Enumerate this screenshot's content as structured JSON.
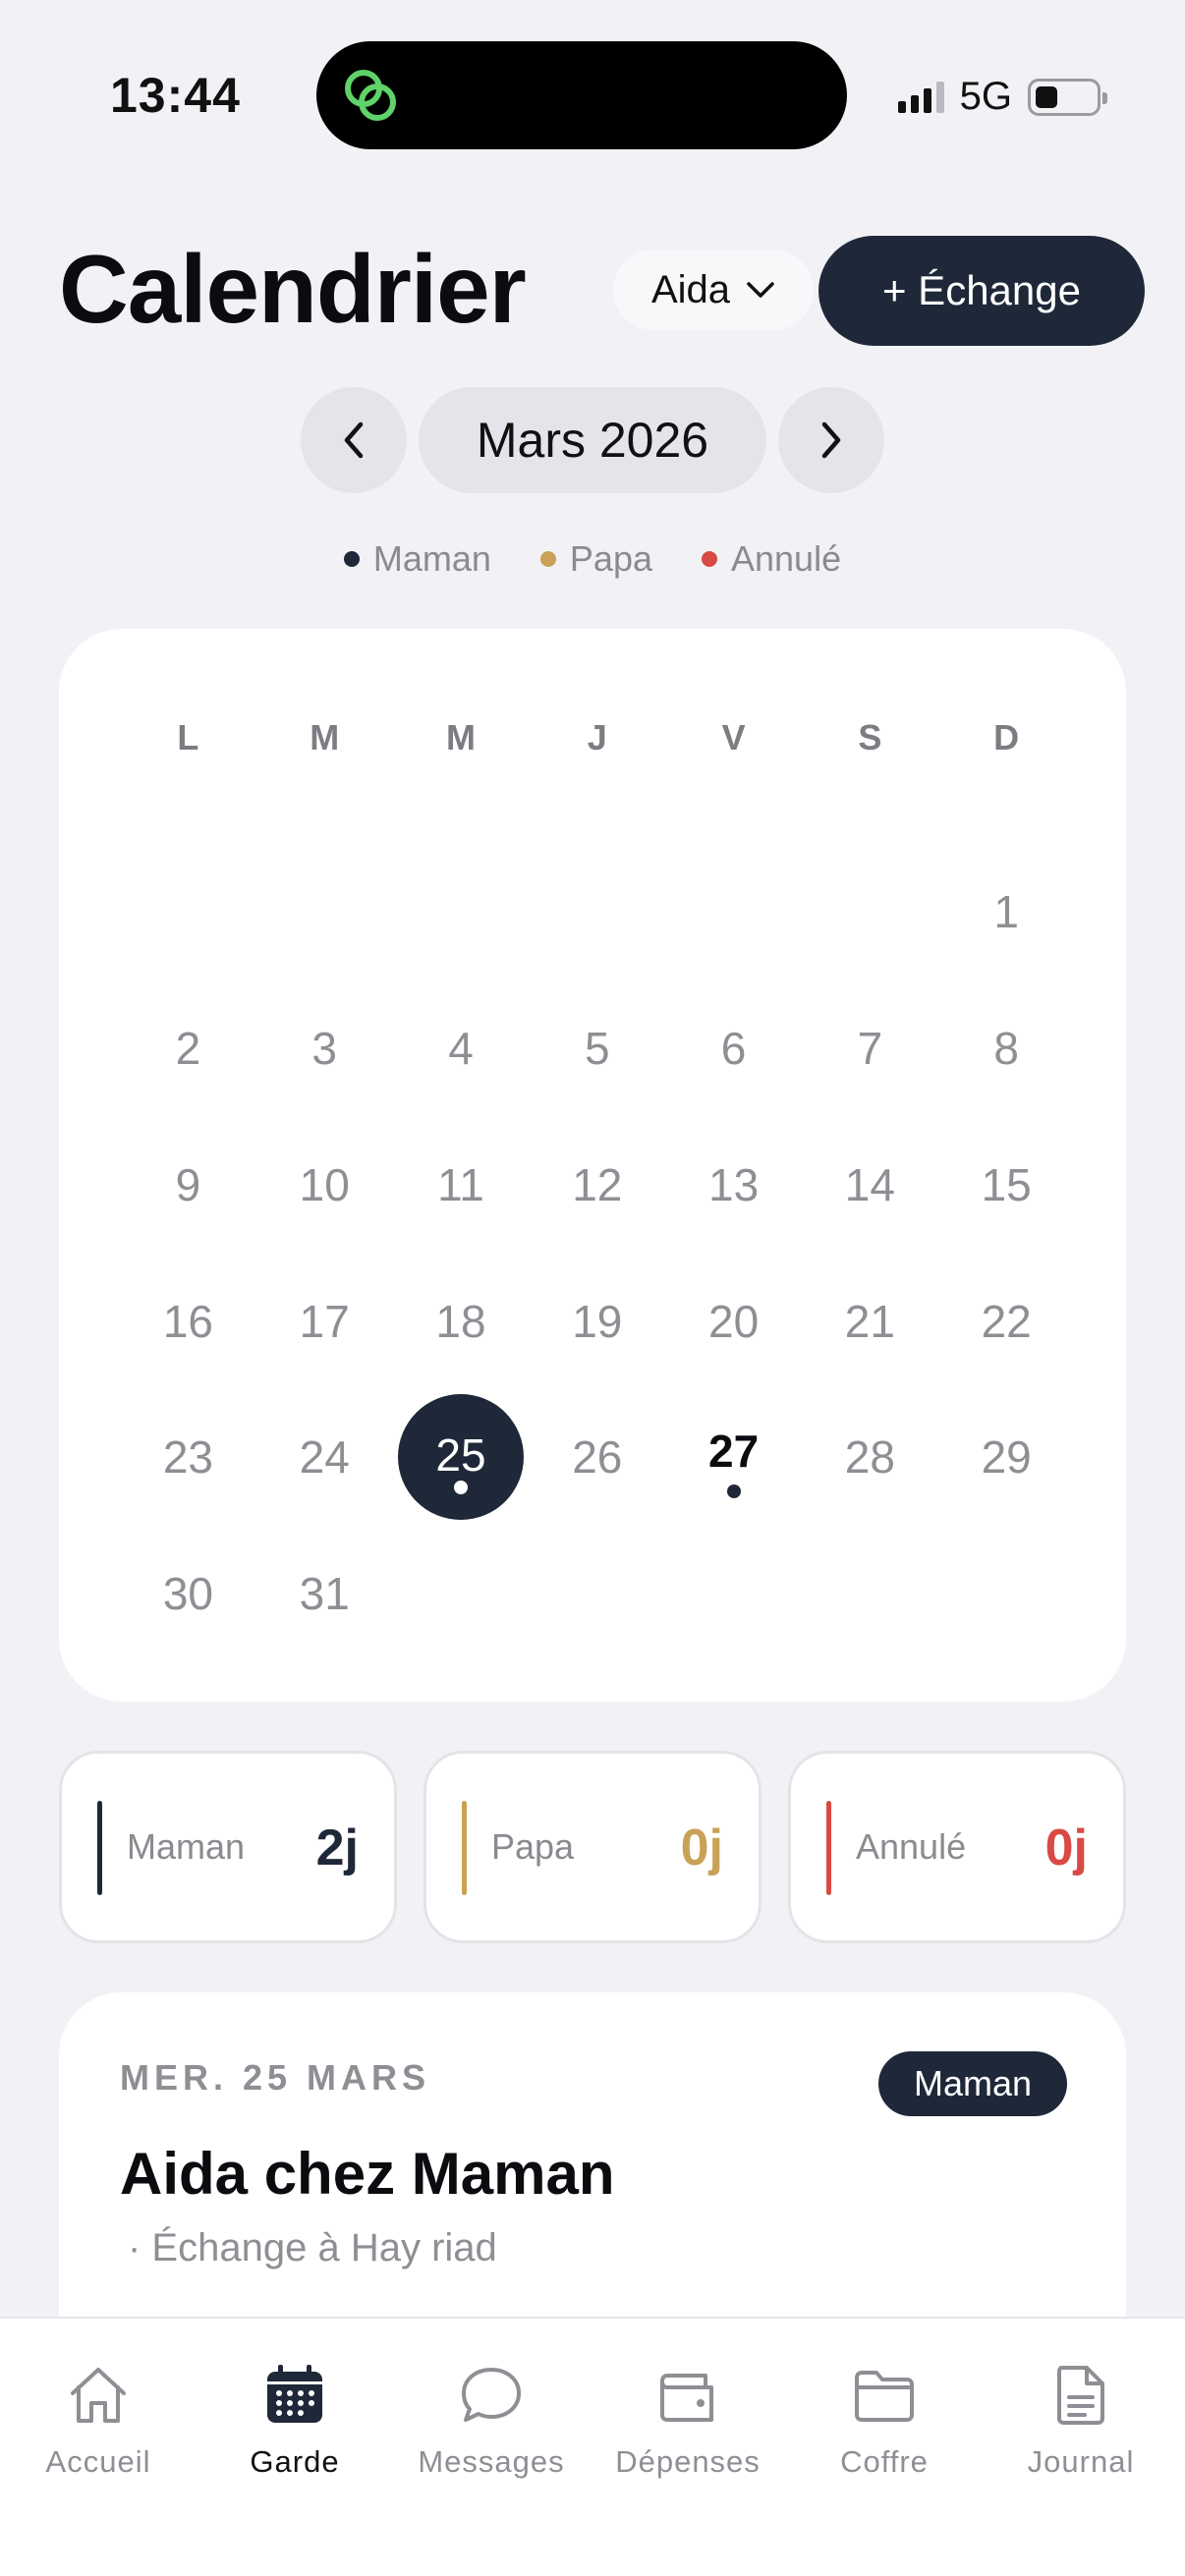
{
  "status_bar": {
    "time": "13:44",
    "network": "5G"
  },
  "header": {
    "title": "Calendrier",
    "child_selector": "Aida",
    "exchange_button": "+ Échange"
  },
  "month_nav": {
    "month_label": "Mars 2026"
  },
  "legend": [
    {
      "label": "Maman",
      "color": "#1e2838"
    },
    {
      "label": "Papa",
      "color": "#c9a257"
    },
    {
      "label": "Annulé",
      "color": "#d94a44"
    }
  ],
  "calendar": {
    "weekdays": [
      "L",
      "M",
      "M",
      "J",
      "V",
      "S",
      "D"
    ],
    "leading_blanks": 6,
    "days": [
      "1",
      "2",
      "3",
      "4",
      "5",
      "6",
      "7",
      "8",
      "9",
      "10",
      "11",
      "12",
      "13",
      "14",
      "15",
      "16",
      "17",
      "18",
      "19",
      "20",
      "21",
      "22",
      "23",
      "24",
      "25",
      "26",
      "27",
      "28",
      "29",
      "30",
      "31"
    ],
    "selected_day": "25",
    "highlighted_day": "27",
    "marked_days": [
      "25",
      "27"
    ]
  },
  "stats": [
    {
      "label": "Maman",
      "count": "2j",
      "color": "#1e2838"
    },
    {
      "label": "Papa",
      "count": "0j",
      "color": "#c9a257"
    },
    {
      "label": "Annulé",
      "count": "0j",
      "color": "#d94a44"
    }
  ],
  "day_detail": {
    "date": "MER. 25 MARS",
    "badge": "Maman",
    "title": "Aida chez Maman",
    "subtitle": "· Échange à Hay riad"
  },
  "tabbar": {
    "items": [
      {
        "label": "Accueil",
        "icon": "home-icon"
      },
      {
        "label": "Garde",
        "icon": "calendar-icon",
        "active": true
      },
      {
        "label": "Messages",
        "icon": "chat-bubble-icon"
      },
      {
        "label": "Dépenses",
        "icon": "wallet-icon"
      },
      {
        "label": "Coffre",
        "icon": "folder-icon"
      },
      {
        "label": "Journal",
        "icon": "document-icon"
      }
    ]
  }
}
